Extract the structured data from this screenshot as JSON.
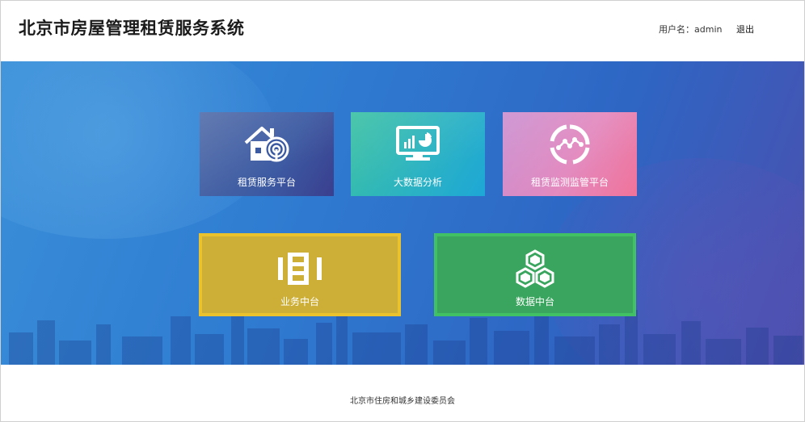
{
  "header": {
    "title": "北京市房屋管理租赁服务系统",
    "user_label": "用户名：admin",
    "logout_label": "退出"
  },
  "tiles": {
    "rental_service": {
      "label": "租赁服务平台",
      "icon": "house-signal-icon"
    },
    "big_data": {
      "label": "大数据分析",
      "icon": "chart-monitor-icon"
    },
    "rental_monitor": {
      "label": "租赁监测监管平台",
      "icon": "network-circle-icon"
    },
    "business_center": {
      "label": "业务中台",
      "icon": "columns-icon"
    },
    "data_center": {
      "label": "数据中台",
      "icon": "hexagon-cluster-icon"
    }
  },
  "footer": {
    "text": "北京市住房和城乡建设委员会"
  },
  "colors": {
    "hero": "#2f7dd2",
    "business": "#cdaf38",
    "data": "#3aa55e"
  }
}
